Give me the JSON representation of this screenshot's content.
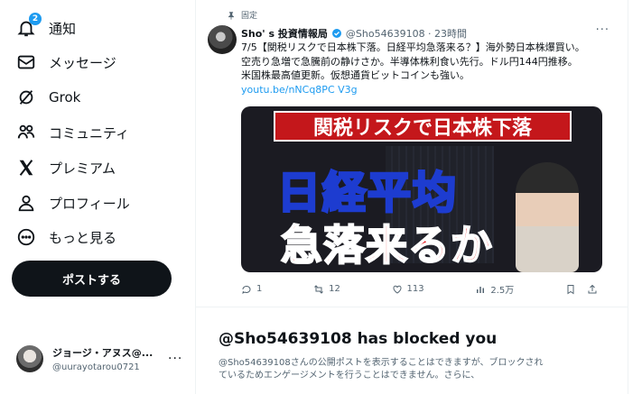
{
  "nav": {
    "items": [
      {
        "label": "通知",
        "icon": "bell-icon",
        "badge": "2"
      },
      {
        "label": "メッセージ",
        "icon": "envelope-icon"
      },
      {
        "label": "Grok",
        "icon": "grok-icon"
      },
      {
        "label": "コミュニティ",
        "icon": "people-icon"
      },
      {
        "label": "プレミアム",
        "icon": "x-logo-icon"
      },
      {
        "label": "プロフィール",
        "icon": "person-icon"
      },
      {
        "label": "もっと見る",
        "icon": "more-circle-icon"
      }
    ],
    "post_button": "ポストする"
  },
  "account": {
    "name": "ジョージ・アヌス@...",
    "handle": "@uurayotarou0721",
    "more": "···"
  },
  "tweet": {
    "pinned_label": "固定",
    "author": "Sho' s 投資情報局",
    "handle_time": "@Sho54639108 · 23時間",
    "more": "···",
    "lines": [
      "7/5【関税リスクで日本株下落。日経平均急落来る？】海外勢日本株爆買い。",
      "空売り急増で急騰前の静けさか。半導体株利食い先行。ドル円144円推移。",
      "米国株最高値更新。仮想通貨ビットコインも強い。"
    ],
    "link": "youtu.be/nNCq8PC V3g",
    "media": {
      "banner": "関税リスクで日本株下落",
      "headline": "日経平均",
      "subheadline": "急落来るか"
    },
    "actions": {
      "replies": "1",
      "reposts": "12",
      "likes": "113",
      "views": "2.5万"
    }
  },
  "blocked": {
    "title": "@Sho54639108 has blocked you",
    "lines": [
      "@Sho54639108さんの公開ポストを表示することはできますが、ブロックされ",
      "ているためエンゲージメントを行うことはできません。さらに、"
    ]
  },
  "colors": {
    "accent": "#1d9bf0",
    "text": "#0f1419",
    "muted": "#536471",
    "button": "#0f1419"
  }
}
